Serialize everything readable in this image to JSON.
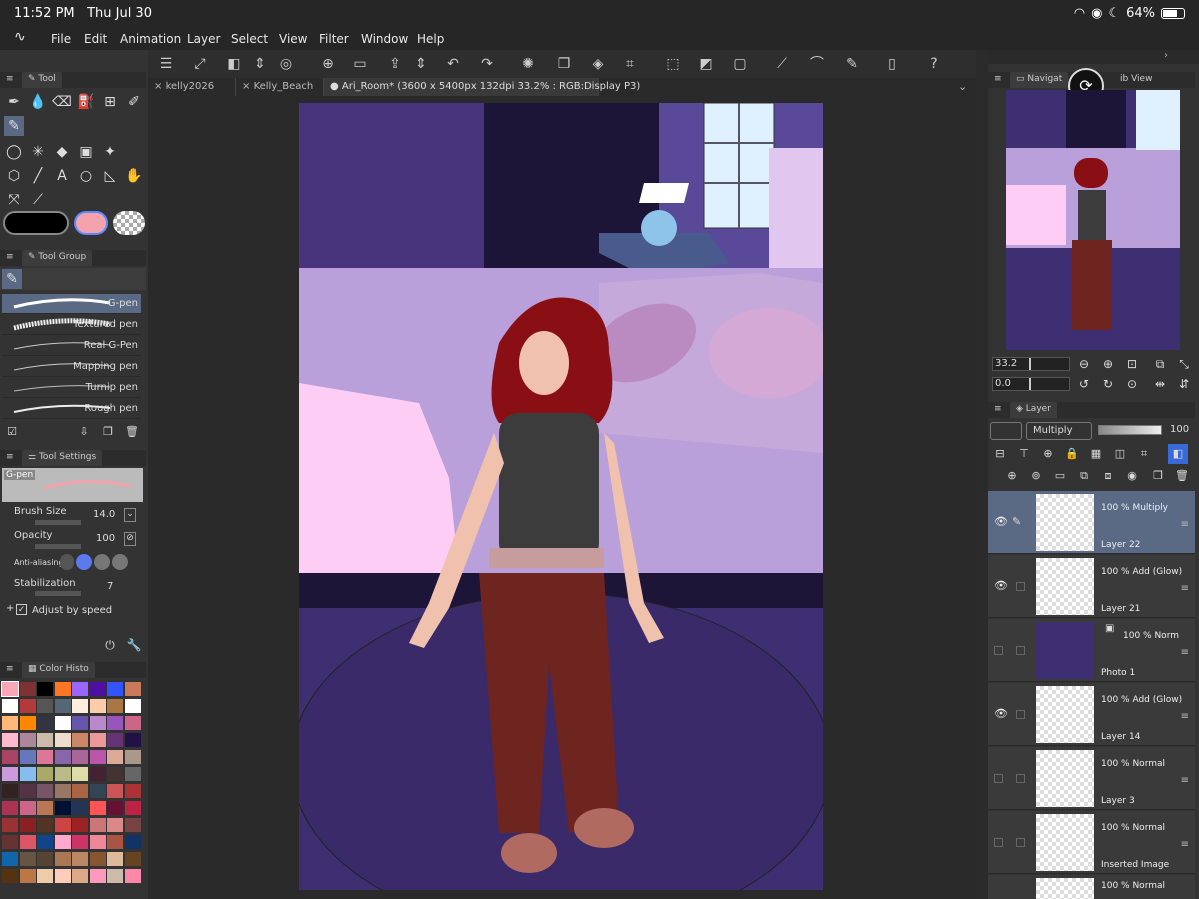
{
  "status": {
    "time": "11:52 PM",
    "date": "Thu Jul 30",
    "battery": "64%"
  },
  "menu": [
    "File",
    "Edit",
    "Animation",
    "Layer",
    "Select",
    "View",
    "Filter",
    "Window",
    "Help"
  ],
  "tabs": [
    {
      "label": "kelly2026"
    },
    {
      "label": "Kelly_Beach"
    },
    {
      "label": "Ari_Room* (3600 x 5400px 132dpi 33.2% : RGB:Display P3)"
    }
  ],
  "left": {
    "tool_panel": "Tool",
    "tool_group_panel": "Tool Group",
    "brushes": [
      "G-pen",
      "Textured pen",
      "Real G-Pen",
      "Mapping pen",
      "Turnip pen",
      "Rough pen"
    ],
    "tool_settings_panel": "Tool Settings",
    "current_brush": "G-pen",
    "brush_size_label": "Brush Size",
    "brush_size": "14.0",
    "opacity_label": "Opacity",
    "opacity": "100",
    "anti_alias_label": "Anti-aliasing",
    "stabilization_label": "Stabilization",
    "stabilization": "7",
    "adjust_label": "Adjust by speed",
    "color_history_panel": "Color Histo"
  },
  "right": {
    "navigator_panel": "Navigat",
    "sub_view_panel": "ib View",
    "zoom": "33.2",
    "rotation": "0.0",
    "layer_panel": "Layer",
    "blend_mode": "Multiply",
    "layer_opacity": "100",
    "layers": [
      {
        "info": "100 %  Multiply",
        "name": "Layer 22"
      },
      {
        "info": "100 %  Add (Glow)",
        "name": "Layer 21"
      },
      {
        "info": "100 %  Norm",
        "name": "Photo 1"
      },
      {
        "info": "100 %  Add (Glow)",
        "name": "Layer 14"
      },
      {
        "info": "100 %  Normal",
        "name": "Layer 3"
      },
      {
        "info": "100 %  Normal",
        "name": "Inserted Image"
      },
      {
        "info": "100 %  Normal",
        "name": ""
      }
    ]
  },
  "colors": {
    "accent": "#5a6a85",
    "main_color": "#000000",
    "sub_color": "#f4a2ad",
    "canvas_bg": "#3e2f72"
  },
  "palette": [
    "#f7a7b5",
    "#7e3333",
    "#000000",
    "#ff7722",
    "#9966ff",
    "#4e0fa1",
    "#3355ff",
    "#c97a5a",
    "#ffffff",
    "#b33a3a",
    "#555555",
    "#556677",
    "#ffeedd",
    "#ffccaa",
    "#aa7744",
    "#ffffff",
    "#ffb877",
    "#ff8800",
    "#333344",
    "#ffffff",
    "#6655aa",
    "#bb88cc",
    "#9955bb",
    "#cc6688",
    "#ffbbcc",
    "#aa8899",
    "#ccbbaa",
    "#eeddcc",
    "#cc8866",
    "#ee9999",
    "#663377",
    "#221144",
    "#aa4466",
    "#6677bb",
    "#dd7799",
    "#8866aa",
    "#aa6699",
    "#bb55aa",
    "#ddaa99",
    "#aa9988",
    "#cc99dd",
    "#88bbee",
    "#aaaa66",
    "#bbbb88",
    "#ddddaa",
    "#442233",
    "#443333",
    "#666666",
    "#332222",
    "#553344",
    "#775566",
    "#997766",
    "#aa6644",
    "#334455",
    "#cc5555",
    "#aa3333",
    "#aa3355",
    "#cc6688",
    "#bb7755",
    "#001133",
    "#223355",
    "#ff5555",
    "#661133",
    "#bb2244",
    "#993333",
    "#882222",
    "#553322",
    "#cc4444",
    "#992222",
    "#cc7777",
    "#dd8888",
    "#774444",
    "#663333",
    "#dd5566",
    "#114488",
    "#ffaacc",
    "#cc3366",
    "#ee8899",
    "#aa5544",
    "#113366",
    "#1166aa",
    "#665544",
    "#554433",
    "#aa7755",
    "#bb8866",
    "#885533",
    "#ddbb99",
    "#664422",
    "#553311",
    "#bb7744",
    "#eeccaa",
    "#ffccbb",
    "#ddaa88",
    "#ff99bb",
    "#ccbbaa",
    "#ff88aa"
  ]
}
